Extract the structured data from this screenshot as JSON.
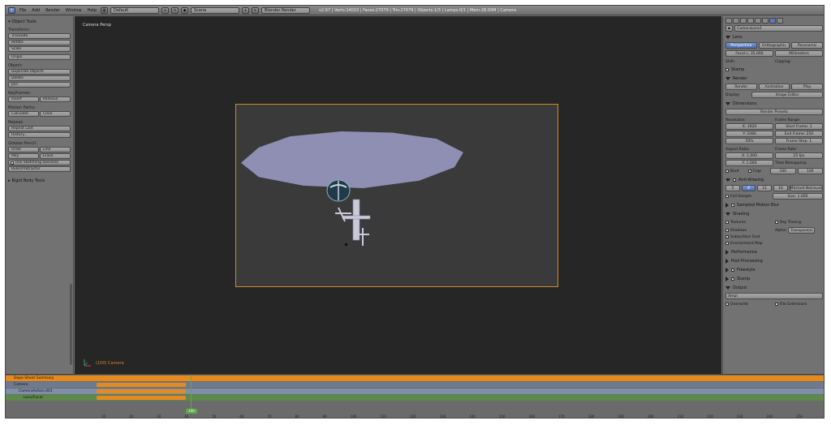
{
  "header": {
    "menus": [
      "File",
      "Add",
      "Render",
      "Window",
      "Help"
    ],
    "screen_layout": "Default",
    "scene": "Scene",
    "render_engine": "Blender Render",
    "stats": "v2.67 | Verts:14010 | Faces:27079 | Tris:27079 | Objects:1/3 | Lamps:0/1 | Mem:28.00M | Camera"
  },
  "tools": {
    "title": "Object Tools",
    "transform_label": "Transform:",
    "transform_buttons": [
      "Translate",
      "Rotate",
      "Scale"
    ],
    "origin_button": "Origin",
    "object_label": "Object:",
    "object_buttons": [
      "Duplicate Objects",
      "Delete",
      "Join"
    ],
    "keyframes_label": "Keyframes:",
    "keyframe_buttons": [
      "Insert",
      "Remove"
    ],
    "motion_paths_label": "Motion Paths:",
    "motion_paths_buttons": [
      "Calculate",
      "Clear"
    ],
    "repeat_label": "Repeat:",
    "repeat_buttons": [
      "Repeat Last",
      "History..."
    ],
    "grease_pencil_label": "Grease Pencil:",
    "grease_buttons_1": [
      "Draw",
      "Line"
    ],
    "grease_buttons_2": [
      "Poly",
      "Erase"
    ],
    "sketching_label": "Use Sketching Sessions",
    "ruler_button": "Ruler/Protractor",
    "rigid_body_title": "Rigid Body Tools"
  },
  "viewport": {
    "label": "Camera Persp",
    "object_name": "(100) Camera"
  },
  "properties": {
    "object_name": "CameraLens1",
    "lens_title": "Lens",
    "lens_tabs": [
      "Perspective",
      "Orthographic",
      "Panoramic"
    ],
    "focal": "Focal L: 35.000",
    "units": "Millimeters",
    "shift_label": "Shift:",
    "clipping_label": "Clipping:",
    "stamp_label": "Stamp",
    "render_title": "Render",
    "render_buttons": [
      "Render",
      "Animation",
      "Play"
    ],
    "display_label": "Display:",
    "display_value": "Image Editor",
    "dimensions_title": "Dimensions",
    "preset": "Render Presets",
    "resolution_label": "Resolution:",
    "res_x": "X: 1920",
    "res_y": "Y: 1080",
    "res_pct": "50%",
    "frame_range_label": "Frame Range:",
    "start_frame": "Start Frame: 1",
    "end_frame": "End Frame: 250",
    "frame_step": "Frame Step: 1",
    "aspect_label": "Aspect Ratio:",
    "aspect_x": "X: 1.000",
    "aspect_y": "Y: 1.000",
    "frame_rate_label": "Frame Rate:",
    "frame_rate": "25 fps",
    "time_remap_label": "Time Remapping:",
    "remap_old": "100",
    "remap_new": "100",
    "border_label": "Bord",
    "crop_label": "Crop",
    "aa_title": "Anti-Aliasing",
    "aa_samples": [
      "5",
      "8",
      "11",
      "16"
    ],
    "aa_filter": "Mitchell-Netravali",
    "full_sample": "Full Sample",
    "aa_size": "Size: 1.000",
    "motion_blur_title": "Sampled Motion Blur",
    "shading_title": "Shading",
    "textures": "Textures",
    "ray_tracing": "Ray Tracing",
    "shadows": "Shadows",
    "alpha_label": "Alpha:",
    "alpha_value": "Transparent",
    "sss": "Subsurface Scat",
    "env_map": "Environment Map",
    "performance_title": "Performance",
    "post_processing_title": "Post Processing",
    "freestyle_title": "Freestyle",
    "stamp_title": "Stamp",
    "output_title": "Output",
    "output_path": "/tmp\\",
    "overwrite": "Overwrite",
    "file_extensions": "File Extensions"
  },
  "timeline": {
    "rows": [
      "Dope Sheet Summary",
      "Camera",
      "CameraAction.001",
      "Lens/Focal"
    ],
    "current_frame": "100",
    "ruler_ticks": [
      "10",
      "20",
      "30",
      "40",
      "50",
      "60",
      "70",
      "80",
      "90",
      "100",
      "110",
      "120",
      "130",
      "140",
      "150",
      "160",
      "170",
      "180",
      "190",
      "200",
      "210",
      "220",
      "230",
      "240",
      "250"
    ]
  },
  "colors": {
    "accent": "#e58a1f",
    "selection": "#5a7ac0",
    "playhead": "#5ca84a",
    "mesh": "#8f8fb4"
  }
}
